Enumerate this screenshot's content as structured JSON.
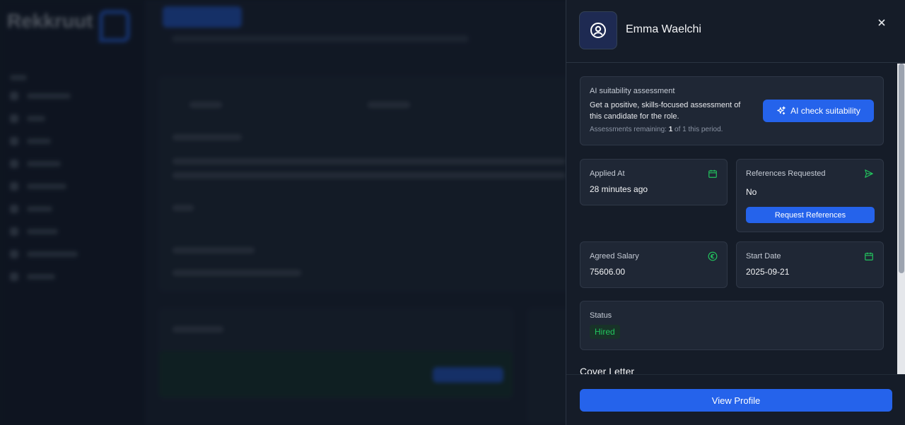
{
  "background": {
    "logo": "Rekkruut",
    "nav_count": 9
  },
  "candidate": {
    "name": "Emma Waelchi",
    "avatar_icon": "user-circle-icon"
  },
  "ai": {
    "title": "AI suitability assessment",
    "description": "Get a positive, skills-focused assessment of this candidate for the role.",
    "remaining_prefix": "Assessments remaining: ",
    "remaining_count": "1",
    "remaining_suffix": " of 1 this period.",
    "button_label": "AI check suitability",
    "button_icon": "sparkles-icon"
  },
  "applied": {
    "label": "Applied At",
    "value": "28 minutes ago",
    "icon": "calendar-icon"
  },
  "references": {
    "label": "References Requested",
    "value": "No",
    "icon": "send-icon",
    "button_label": "Request References"
  },
  "salary": {
    "label": "Agreed Salary",
    "value": "75606.00",
    "icon": "euro-icon"
  },
  "start_date": {
    "label": "Start Date",
    "value": "2025-09-21",
    "icon": "calendar-icon"
  },
  "status": {
    "label": "Status",
    "value": "Hired"
  },
  "cover_letter": {
    "title": "Cover Letter"
  },
  "footer": {
    "view_profile_label": "View Profile"
  },
  "colors": {
    "accent": "#2563eb",
    "success": "#22c55e",
    "panel": "#151c28",
    "card": "#1f2735"
  }
}
